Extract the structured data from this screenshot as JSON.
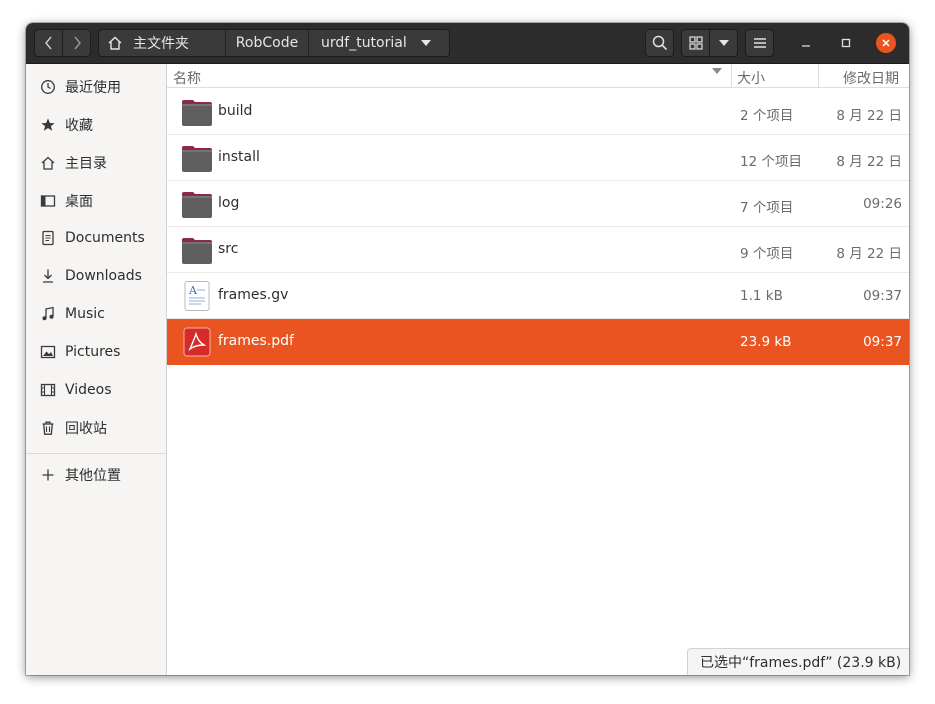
{
  "colors": {
    "accent": "#e95420",
    "headerbar": "#2c2c2c",
    "sidebar": "#f6f5f4"
  },
  "breadcrumb": [
    {
      "label": "主文件夹",
      "icon": "home-icon"
    },
    {
      "label": "RobCode"
    },
    {
      "label": "urdf_tutorial",
      "icon": "chevron-down-icon"
    }
  ],
  "header_icons": [
    "back-icon",
    "forward-icon",
    "search-icon",
    "grid-view-icon",
    "chevron-down-icon",
    "hamburger-menu-icon",
    "minimize-icon",
    "maximize-icon",
    "close-icon"
  ],
  "sidebar": {
    "items": [
      {
        "label": "最近使用",
        "icon": "clock-icon"
      },
      {
        "label": "收藏",
        "icon": "star-icon"
      },
      {
        "label": "主目录",
        "icon": "home-icon"
      },
      {
        "label": "桌面",
        "icon": "desktop-icon"
      },
      {
        "label": "Documents",
        "icon": "document-icon"
      },
      {
        "label": "Downloads",
        "icon": "download-icon"
      },
      {
        "label": "Music",
        "icon": "music-icon"
      },
      {
        "label": "Pictures",
        "icon": "picture-icon"
      },
      {
        "label": "Videos",
        "icon": "film-icon"
      },
      {
        "label": "回收站",
        "icon": "trash-icon"
      }
    ],
    "other": {
      "label": "其他位置",
      "icon": "plus-icon"
    }
  },
  "columns": {
    "name": "名称",
    "size": "大小",
    "modified": "修改日期"
  },
  "files": [
    {
      "name": "build",
      "size": "2 个项目",
      "modified": "8 月 22 日",
      "type": "folder"
    },
    {
      "name": "install",
      "size": "12 个项目",
      "modified": "8 月 22 日",
      "type": "folder"
    },
    {
      "name": "log",
      "size": "7 个项目",
      "modified": "09:26",
      "type": "folder"
    },
    {
      "name": "src",
      "size": "9 个项目",
      "modified": "8 月 22 日",
      "type": "folder"
    },
    {
      "name": "frames.gv",
      "size": "1.1 kB",
      "modified": "09:37",
      "type": "text"
    },
    {
      "name": "frames.pdf",
      "size": "23.9 kB",
      "modified": "09:37",
      "type": "pdf",
      "selected": true
    }
  ],
  "status": "已选中“frames.pdf” (23.9 kB)"
}
